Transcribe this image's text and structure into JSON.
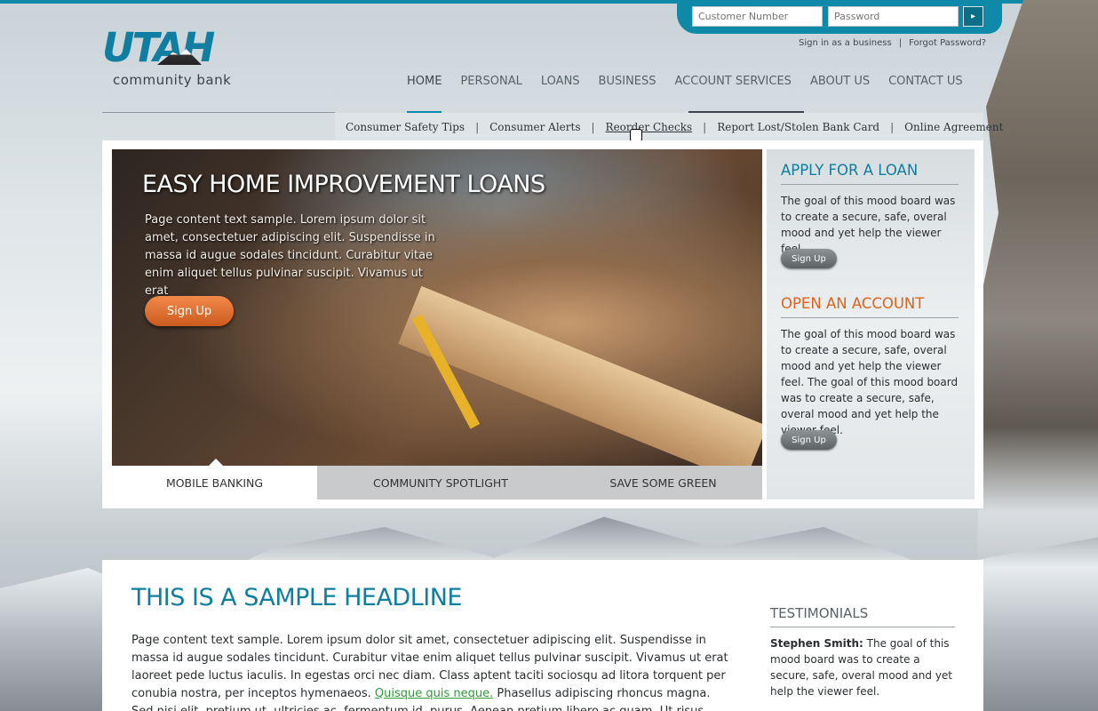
{
  "login": {
    "customer_placeholder": "Customer Number",
    "password_placeholder": "Password",
    "go_icon": "arrow-right-icon",
    "business_link": "Sign in as a business",
    "separator": "|",
    "forgot_link": "Forgot Password?"
  },
  "logo": {
    "word": "UTAH",
    "subtitle": "community bank"
  },
  "nav": {
    "items": [
      "HOME",
      "PERSONAL",
      "LOANS",
      "BUSINESS",
      "ACCOUNT SERVICES",
      "ABOUT US",
      "CONTACT US"
    ],
    "active": "HOME"
  },
  "subnav": {
    "items": [
      "Consumer Safety Tips",
      "Consumer Alerts",
      "Reorder Checks",
      "Report Lost/Stolen Bank Card",
      "Online Agreement"
    ],
    "separator": "|"
  },
  "hero": {
    "title": "EASY HOME IMPROVEMENT LOANS",
    "text": "Page content text sample. Lorem ipsum dolor sit amet, consectetuer  adipiscing elit. Suspendisse in massa id augue sodales tincidunt. Curabitur vitae enim aliquet tellus pulvinar suscipit. Vivamus ut erat",
    "button": "Sign Up"
  },
  "tabs": [
    "MOBILE BANKING",
    "COMMUNITY SPOTLIGHT",
    "SAVE SOME GREEN"
  ],
  "sidebar": {
    "loan_heading": "APPLY FOR A LOAN",
    "loan_text": "The goal of this mood board was to create a secure, safe, overal mood and yet help the viewer feel.",
    "loan_button": "Sign Up",
    "account_heading": "OPEN AN ACCOUNT",
    "account_text": "The goal of this mood board was to create a secure, safe, overal mood and yet help the viewer feel. The goal of this mood board was to create a secure, safe, overal mood and yet help the viewer feel.",
    "account_button": "Sign Up"
  },
  "content": {
    "headline": "THIS IS A SAMPLE HEADLINE",
    "body_before": "Page content text sample. Lorem ipsum dolor sit amet, consectetuer  adipiscing elit. Suspendisse in massa id augue sodales tincidunt. Curabitur vitae enim aliquet tellus pulvinar suscipit. Vivamus ut erat laoreet pede luctus iaculis. In egestas orci nec diam. Class aptent taciti sociosqu ad litora torquent per conubia nostra, per inceptos hymenaeos. ",
    "body_link": "Quisque quis neque.",
    "body_after": " Phasellus adipiscing rhoncus magna. Sed nisi elit, pretium ut, ultricies ac, fermentum id, purus. Aenean pretium libero ac quam. Ut risus metus, dictum nec"
  },
  "testimonials": {
    "heading": "TESTIMONIALS",
    "author": "Stephen Smith:",
    "quote": " The goal of this mood board was to create a secure, safe, overal mood and yet help the viewer feel."
  },
  "colors": {
    "brand_teal": "#0e89a8",
    "headline_blue": "#0f7ea0",
    "loan_heading": "#0f7ea0",
    "account_heading": "#d9651e",
    "hero_button": "#e0713a",
    "link_green": "#2f9b3a"
  }
}
